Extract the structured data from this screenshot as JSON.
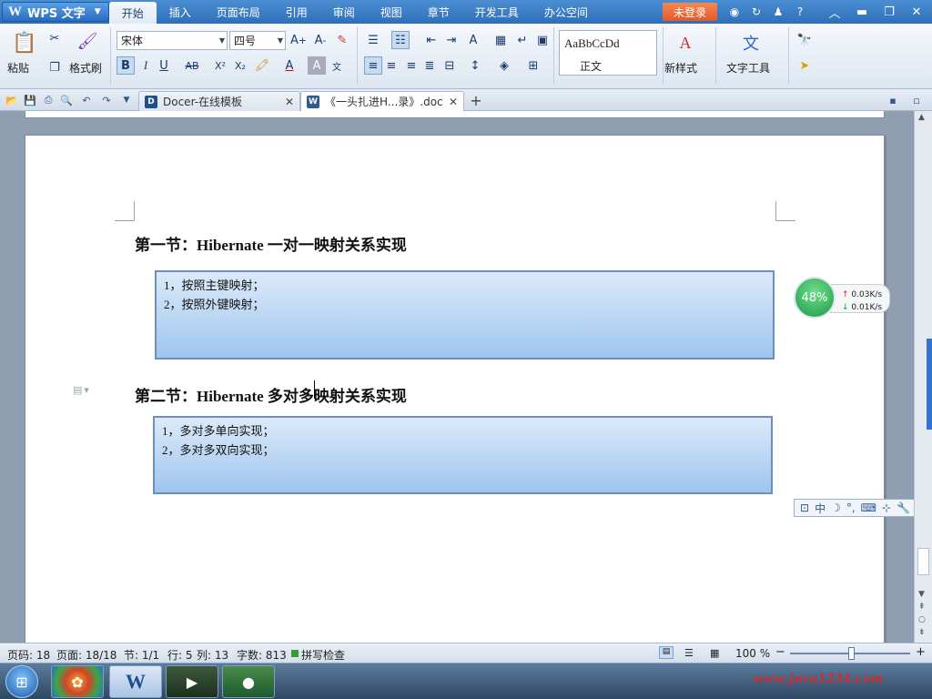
{
  "app": {
    "logo_text": "WPS 文字",
    "login": "未登录"
  },
  "menu": [
    "开始",
    "插入",
    "页面布局",
    "引用",
    "审阅",
    "视图",
    "章节",
    "开发工具",
    "办公空间"
  ],
  "ribbon": {
    "paste_label": "粘贴",
    "format_painter_label": "格式刷",
    "font_name": "宋体",
    "font_size": "四号",
    "style_preview": "AaBbCcDd",
    "style_name": "正文",
    "new_style_label": "新样式",
    "text_tools_label": "文字工具"
  },
  "tabs": [
    {
      "label": "Docer-在线模板"
    },
    {
      "label": "《一头扎进H...录》.doc"
    }
  ],
  "document": {
    "section1_title": "第一节：Hibernate 一对一映射关系实现",
    "section1_items": [
      "1，按照主键映射；",
      "2，按照外键映射；"
    ],
    "section2_title": "第二节：Hibernate 多对多映射关系实现",
    "section2_items": [
      "1，多对多单向实现；",
      "2，多对多双向实现；"
    ]
  },
  "net_widget": {
    "percent": "48%",
    "up": "0.03K/s",
    "down": "0.01K/s"
  },
  "ime": {
    "mode": "中"
  },
  "status": {
    "page_no": "页码: 18",
    "pages": "页面: 18/18",
    "section": "节: 1/1",
    "row": "行: 5",
    "col": "列: 13",
    "wordcount": "字数: 813",
    "spellcheck": "拼写检查",
    "zoom": "100 %"
  },
  "taskbar": {
    "watermark": "www.java1234.com"
  }
}
